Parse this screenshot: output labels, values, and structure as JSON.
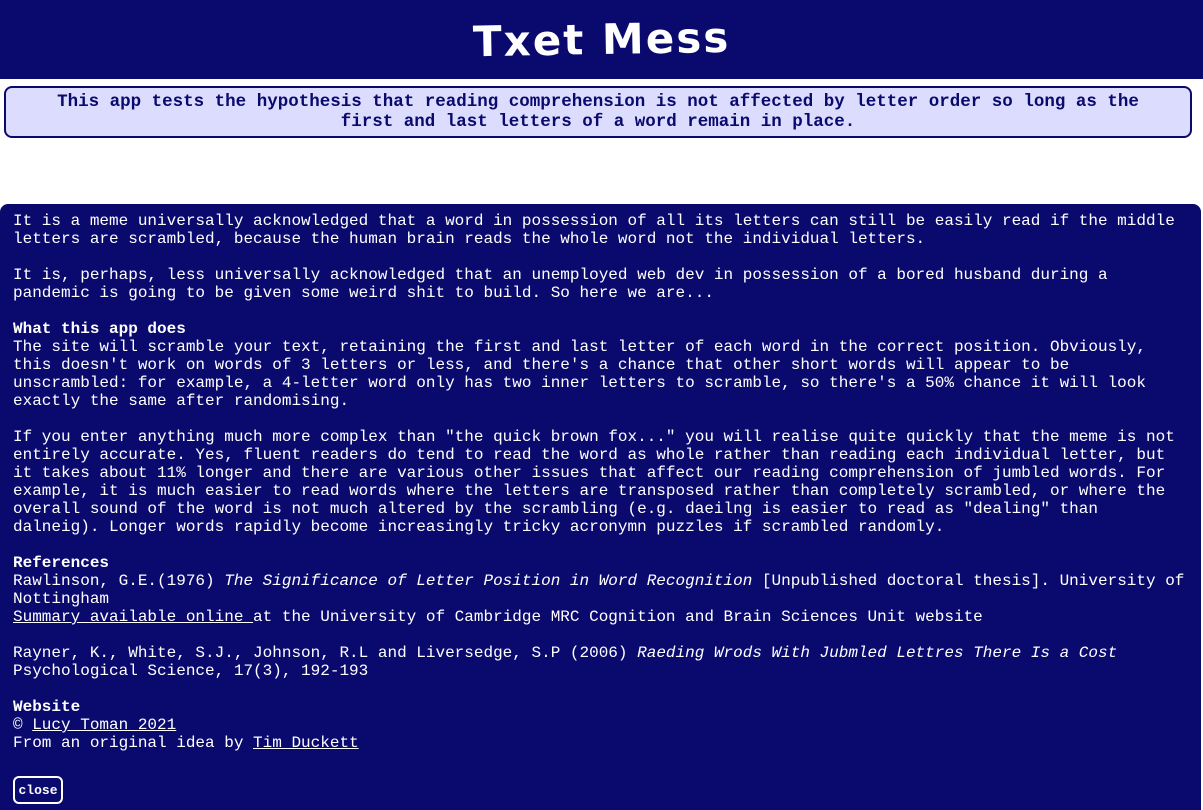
{
  "header": {
    "title": "Txet Mess"
  },
  "intro": {
    "text": "This app tests the hypothesis that reading comprehension is not affected by letter order so long as the first and last letters of a word remain in place."
  },
  "about": {
    "para1": "It is a meme universally acknowledged that a word in possession of all its letters can still be easily read if the middle letters are scrambled, because the human brain reads the whole word not the individual letters.",
    "para2": "It is, perhaps, less universally acknowledged that an unemployed web dev in possession of a bored husband during a pandemic is going to be given some weird shit to build. So here we are...",
    "what_heading": "What this app does",
    "what_body": "The site will scramble your text, retaining the first and last letter of each word in the correct position. Obviously, this doesn't work on words of 3 letters or less, and there's a chance that other short words will appear to be unscrambled: for example, a 4-letter word only has two inner letters to scramble, so there's a 50% chance it will look exactly the same after randomising.",
    "para4": "If you enter anything much more complex than \"the quick brown fox...\" you will realise quite quickly that the meme is not entirely accurate. Yes, fluent readers do tend to read the word as whole rather than reading each individual letter, but it takes about 11% longer and there are various other issues that affect our reading comprehension of jumbled words. For example, it is much easier to read words where the letters are transposed rather than completely scrambled, or where the overall sound of the word is not much altered by the scrambling (e.g. daeilng is easier to read as \"dealing\" than dalneig). Longer words rapidly become increasingly tricky acronymn puzzles if scrambled randomly.",
    "references_heading": "References",
    "ref1_authors": "Rawlinson, G.E.(1976) ",
    "ref1_title": "The Significance of Letter Position in Word Recognition",
    "ref1_rest": " [Unpublished doctoral thesis]. University of Nottingham",
    "ref1_link": "Summary available online ",
    "ref1_link_rest": "at the University of Cambridge MRC Cognition and Brain Sciences Unit website",
    "ref2_authors": "Rayner, K., White, S.J., Johnson, R.L and Liversedge, S.P (2006) ",
    "ref2_title": "Raeding Wrods With Jubmled Lettres There Is a Cost",
    "ref2_journal": "Psychological Science, 17(3), 192-193",
    "website_heading": "Website",
    "copyright_symbol": "© ",
    "author_link": "Lucy Toman 2021",
    "idea_prefix": "From an original idea by ",
    "idea_link": "Tim Duckett"
  },
  "close_label": "close",
  "colors": {
    "navy": "#0a0a6e",
    "light_panel": "#dcdcff",
    "white": "#ffffff"
  }
}
